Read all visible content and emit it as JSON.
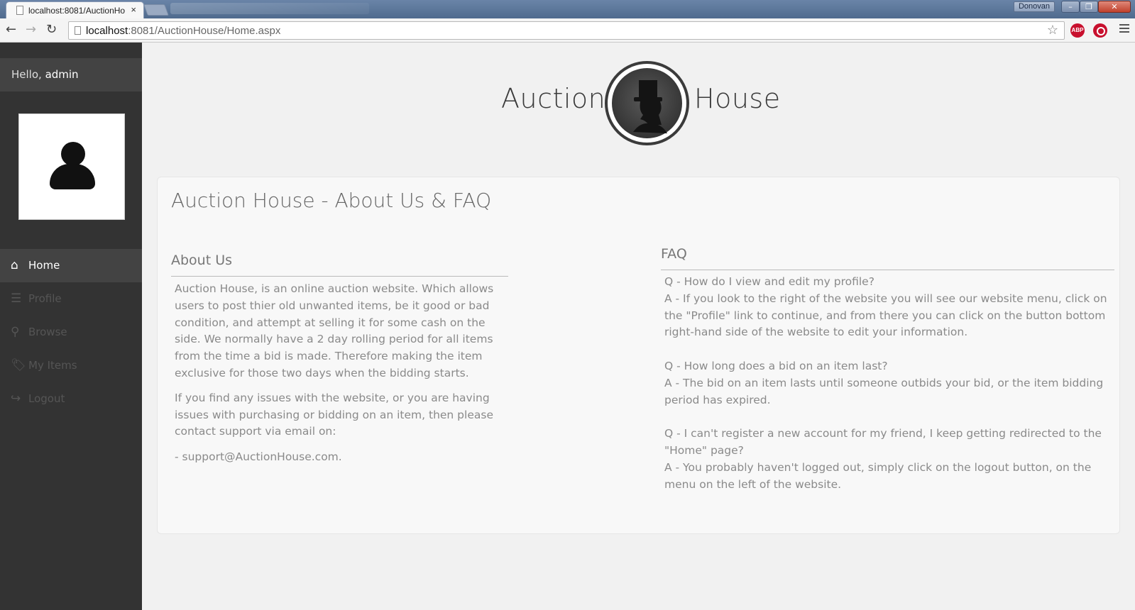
{
  "browser": {
    "tab_title": "localhost:8081/AuctionHo",
    "tab_close": "×",
    "url_host": "localhost",
    "url_path": ":8081/AuctionHouse/Home.aspx",
    "user_badge": "Donovan",
    "ext_abp": "ABP",
    "win_min": "–",
    "win_max": "❐",
    "win_close": "✕"
  },
  "sidebar": {
    "greeting_prefix": "Hello, ",
    "greeting_name": "admin",
    "items": [
      {
        "label": "Home",
        "icon": "home-icon",
        "glyph": "⌂",
        "active": true
      },
      {
        "label": "Profile",
        "icon": "bars-icon",
        "glyph": "☰",
        "active": false
      },
      {
        "label": "Browse",
        "icon": "search-icon",
        "glyph": "⚲",
        "active": false
      },
      {
        "label": "My Items",
        "icon": "tags-icon",
        "glyph": "🏷",
        "active": false
      },
      {
        "label": "Logout",
        "icon": "logout-icon",
        "glyph": "↪",
        "active": false
      }
    ]
  },
  "logo": {
    "left_word": "Auction",
    "right_word": "House"
  },
  "page": {
    "title": "Auction House - About Us & FAQ",
    "about_title": "About Us",
    "about_paragraphs": [
      "Auction House, is an online auction website. Which allows users to post thier old unwanted items, be it good or bad condition, and attempt at selling it for some cash on the side. We normally have a 2 day rolling period for all items from the time a bid is made. Therefore making the item exclusive for those two days when the bidding starts.",
      "If you find any issues with the website, or you are having issues with purchasing or bidding on an item, then please contact support via email on:"
    ],
    "support_email": "- support@AuctionHouse.com.",
    "faq_title": "FAQ",
    "faq": [
      {
        "q": "Q - How do I view and edit my profile?",
        "a": "A - If you look to the right of the website you will see our website menu, click on the \"Profile\" link to continue, and from there you can click on the button bottom right-hand side of the website to edit your information."
      },
      {
        "q": "Q - How long does a bid on an item last?",
        "a": "A - The bid on an item lasts until someone outbids your bid, or the item bidding period has expired."
      },
      {
        "q": "Q - I can't register a new account for my friend, I keep getting redirected to the \"Home\" page?",
        "a": "A - You probably haven't logged out, simply click on the logout button, on the menu on the left of the website."
      }
    ]
  }
}
